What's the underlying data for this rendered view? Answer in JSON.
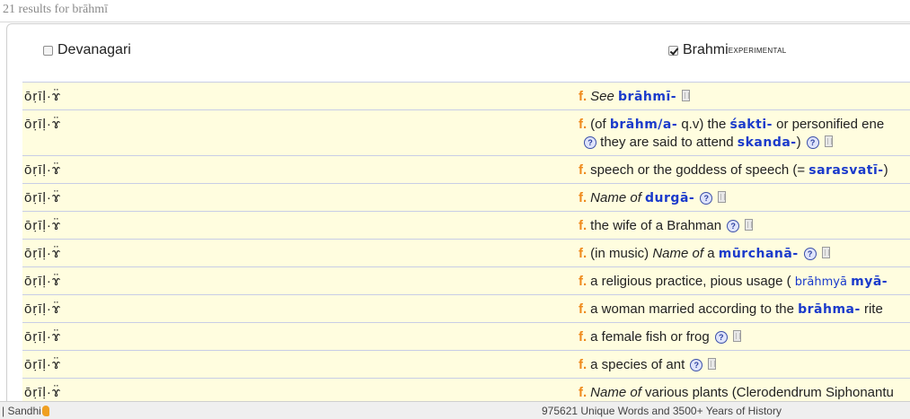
{
  "results_label": "21 results for brāhmī",
  "toggles": {
    "devanagari": {
      "label": "Devanagari",
      "checked": false
    },
    "brahmi": {
      "label": "Brahmi",
      "sup": "EXPERIMENTAL",
      "checked": true
    }
  },
  "rows": [
    {
      "word": "ōṛīḷ·ɤ̈",
      "gender": "f.",
      "parts": [
        {
          "t": "i",
          "v": "See "
        },
        {
          "t": "lnk",
          "v": "brāhmī-"
        },
        {
          "t": "book"
        }
      ]
    },
    {
      "word": "ōṛīḷ·ɤ̈",
      "gender": "f.",
      "tall": true,
      "parts": [
        {
          "t": "txt",
          "v": "(of "
        },
        {
          "t": "lnk",
          "v": "brāhm/a-"
        },
        {
          "t": "txt",
          "v": " q.v) the "
        },
        {
          "t": "lnk",
          "v": "śakti-"
        },
        {
          "t": "txt",
          "v": " or personified ene"
        },
        {
          "t": "br"
        },
        {
          "t": "help"
        },
        {
          "t": "txt",
          "v": " they are said to attend "
        },
        {
          "t": "lnk",
          "v": "skanda-"
        },
        {
          "t": "txt",
          "v": ")"
        },
        {
          "t": "help"
        },
        {
          "t": "book"
        }
      ]
    },
    {
      "word": "ōṛīḷ·ɤ̈",
      "gender": "f.",
      "parts": [
        {
          "t": "txt",
          "v": "speech or the goddess of speech (= "
        },
        {
          "t": "lnk",
          "v": "sarasvatī-"
        },
        {
          "t": "txt",
          "v": ")"
        }
      ]
    },
    {
      "word": "ōṛīḷ·ɤ̈",
      "gender": "f.",
      "parts": [
        {
          "t": "i",
          "v": "Name of "
        },
        {
          "t": "lnk",
          "v": "durgā-"
        },
        {
          "t": "help"
        },
        {
          "t": "book"
        }
      ]
    },
    {
      "word": "ōṛīḷ·ɤ̈",
      "gender": "f.",
      "parts": [
        {
          "t": "txt",
          "v": "the wife of a Brahman"
        },
        {
          "t": "help"
        },
        {
          "t": "book"
        }
      ]
    },
    {
      "word": "ōṛīḷ·ɤ̈",
      "gender": "f.",
      "parts": [
        {
          "t": "txt",
          "v": "(in music) "
        },
        {
          "t": "i",
          "v": "Name of"
        },
        {
          "t": "txt",
          "v": " a "
        },
        {
          "t": "lnk",
          "v": "mūrchanā-"
        },
        {
          "t": "help"
        },
        {
          "t": "book"
        }
      ]
    },
    {
      "word": "ōṛīḷ·ɤ̈",
      "gender": "f.",
      "parts": [
        {
          "t": "txt",
          "v": "a religious practice, pious usage ( "
        },
        {
          "t": "lnk2",
          "v": "brāhmyā"
        },
        {
          "t": "txt",
          "v": " "
        },
        {
          "t": "lnk",
          "v": "myā-"
        }
      ]
    },
    {
      "word": "ōṛīḷ·ɤ̈",
      "gender": "f.",
      "parts": [
        {
          "t": "txt",
          "v": "a woman married according to the "
        },
        {
          "t": "lnk",
          "v": "brāhma-"
        },
        {
          "t": "txt",
          "v": " rite"
        }
      ]
    },
    {
      "word": "ōṛīḷ·ɤ̈",
      "gender": "f.",
      "parts": [
        {
          "t": "txt",
          "v": "a female fish or frog"
        },
        {
          "t": "help"
        },
        {
          "t": "book"
        }
      ]
    },
    {
      "word": "ōṛīḷ·ɤ̈",
      "gender": "f.",
      "parts": [
        {
          "t": "txt",
          "v": "a species of ant"
        },
        {
          "t": "help"
        },
        {
          "t": "book"
        }
      ]
    },
    {
      "word": "ōṛīḷ·ɤ̈",
      "gender": "f.",
      "parts": [
        {
          "t": "i",
          "v": "Name of"
        },
        {
          "t": "txt",
          "v": " various plants (Clerodendrum Siphonantu"
        }
      ]
    }
  ],
  "footer": {
    "sandhi": "| Sandhi",
    "stats": "975621 Unique Words and 3500+ Years of History"
  },
  "icons": {
    "help": "?"
  }
}
